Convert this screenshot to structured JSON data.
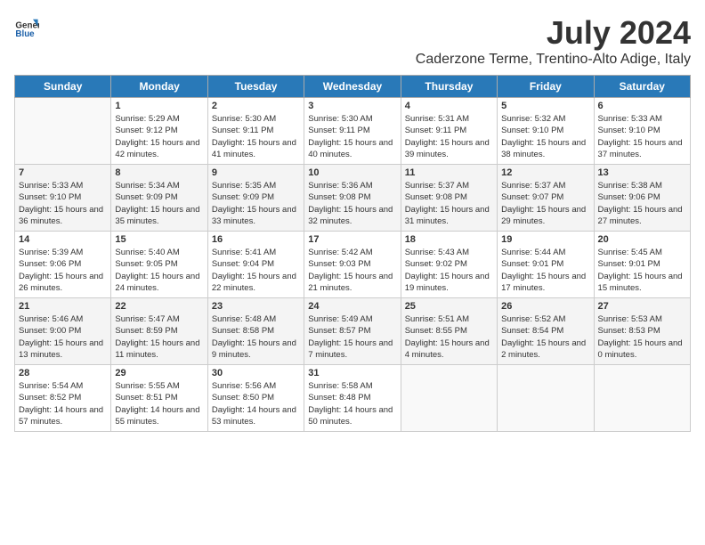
{
  "header": {
    "logo_line1": "General",
    "logo_line2": "Blue",
    "title": "July 2024",
    "subtitle": "Caderzone Terme, Trentino-Alto Adige, Italy"
  },
  "weekdays": [
    "Sunday",
    "Monday",
    "Tuesday",
    "Wednesday",
    "Thursday",
    "Friday",
    "Saturday"
  ],
  "weeks": [
    [
      {
        "day": "",
        "empty": true
      },
      {
        "day": "1",
        "sunrise": "Sunrise: 5:29 AM",
        "sunset": "Sunset: 9:12 PM",
        "daylight": "Daylight: 15 hours and 42 minutes."
      },
      {
        "day": "2",
        "sunrise": "Sunrise: 5:30 AM",
        "sunset": "Sunset: 9:11 PM",
        "daylight": "Daylight: 15 hours and 41 minutes."
      },
      {
        "day": "3",
        "sunrise": "Sunrise: 5:30 AM",
        "sunset": "Sunset: 9:11 PM",
        "daylight": "Daylight: 15 hours and 40 minutes."
      },
      {
        "day": "4",
        "sunrise": "Sunrise: 5:31 AM",
        "sunset": "Sunset: 9:11 PM",
        "daylight": "Daylight: 15 hours and 39 minutes."
      },
      {
        "day": "5",
        "sunrise": "Sunrise: 5:32 AM",
        "sunset": "Sunset: 9:10 PM",
        "daylight": "Daylight: 15 hours and 38 minutes."
      },
      {
        "day": "6",
        "sunrise": "Sunrise: 5:33 AM",
        "sunset": "Sunset: 9:10 PM",
        "daylight": "Daylight: 15 hours and 37 minutes."
      }
    ],
    [
      {
        "day": "7",
        "sunrise": "Sunrise: 5:33 AM",
        "sunset": "Sunset: 9:10 PM",
        "daylight": "Daylight: 15 hours and 36 minutes."
      },
      {
        "day": "8",
        "sunrise": "Sunrise: 5:34 AM",
        "sunset": "Sunset: 9:09 PM",
        "daylight": "Daylight: 15 hours and 35 minutes."
      },
      {
        "day": "9",
        "sunrise": "Sunrise: 5:35 AM",
        "sunset": "Sunset: 9:09 PM",
        "daylight": "Daylight: 15 hours and 33 minutes."
      },
      {
        "day": "10",
        "sunrise": "Sunrise: 5:36 AM",
        "sunset": "Sunset: 9:08 PM",
        "daylight": "Daylight: 15 hours and 32 minutes."
      },
      {
        "day": "11",
        "sunrise": "Sunrise: 5:37 AM",
        "sunset": "Sunset: 9:08 PM",
        "daylight": "Daylight: 15 hours and 31 minutes."
      },
      {
        "day": "12",
        "sunrise": "Sunrise: 5:37 AM",
        "sunset": "Sunset: 9:07 PM",
        "daylight": "Daylight: 15 hours and 29 minutes."
      },
      {
        "day": "13",
        "sunrise": "Sunrise: 5:38 AM",
        "sunset": "Sunset: 9:06 PM",
        "daylight": "Daylight: 15 hours and 27 minutes."
      }
    ],
    [
      {
        "day": "14",
        "sunrise": "Sunrise: 5:39 AM",
        "sunset": "Sunset: 9:06 PM",
        "daylight": "Daylight: 15 hours and 26 minutes."
      },
      {
        "day": "15",
        "sunrise": "Sunrise: 5:40 AM",
        "sunset": "Sunset: 9:05 PM",
        "daylight": "Daylight: 15 hours and 24 minutes."
      },
      {
        "day": "16",
        "sunrise": "Sunrise: 5:41 AM",
        "sunset": "Sunset: 9:04 PM",
        "daylight": "Daylight: 15 hours and 22 minutes."
      },
      {
        "day": "17",
        "sunrise": "Sunrise: 5:42 AM",
        "sunset": "Sunset: 9:03 PM",
        "daylight": "Daylight: 15 hours and 21 minutes."
      },
      {
        "day": "18",
        "sunrise": "Sunrise: 5:43 AM",
        "sunset": "Sunset: 9:02 PM",
        "daylight": "Daylight: 15 hours and 19 minutes."
      },
      {
        "day": "19",
        "sunrise": "Sunrise: 5:44 AM",
        "sunset": "Sunset: 9:01 PM",
        "daylight": "Daylight: 15 hours and 17 minutes."
      },
      {
        "day": "20",
        "sunrise": "Sunrise: 5:45 AM",
        "sunset": "Sunset: 9:01 PM",
        "daylight": "Daylight: 15 hours and 15 minutes."
      }
    ],
    [
      {
        "day": "21",
        "sunrise": "Sunrise: 5:46 AM",
        "sunset": "Sunset: 9:00 PM",
        "daylight": "Daylight: 15 hours and 13 minutes."
      },
      {
        "day": "22",
        "sunrise": "Sunrise: 5:47 AM",
        "sunset": "Sunset: 8:59 PM",
        "daylight": "Daylight: 15 hours and 11 minutes."
      },
      {
        "day": "23",
        "sunrise": "Sunrise: 5:48 AM",
        "sunset": "Sunset: 8:58 PM",
        "daylight": "Daylight: 15 hours and 9 minutes."
      },
      {
        "day": "24",
        "sunrise": "Sunrise: 5:49 AM",
        "sunset": "Sunset: 8:57 PM",
        "daylight": "Daylight: 15 hours and 7 minutes."
      },
      {
        "day": "25",
        "sunrise": "Sunrise: 5:51 AM",
        "sunset": "Sunset: 8:55 PM",
        "daylight": "Daylight: 15 hours and 4 minutes."
      },
      {
        "day": "26",
        "sunrise": "Sunrise: 5:52 AM",
        "sunset": "Sunset: 8:54 PM",
        "daylight": "Daylight: 15 hours and 2 minutes."
      },
      {
        "day": "27",
        "sunrise": "Sunrise: 5:53 AM",
        "sunset": "Sunset: 8:53 PM",
        "daylight": "Daylight: 15 hours and 0 minutes."
      }
    ],
    [
      {
        "day": "28",
        "sunrise": "Sunrise: 5:54 AM",
        "sunset": "Sunset: 8:52 PM",
        "daylight": "Daylight: 14 hours and 57 minutes."
      },
      {
        "day": "29",
        "sunrise": "Sunrise: 5:55 AM",
        "sunset": "Sunset: 8:51 PM",
        "daylight": "Daylight: 14 hours and 55 minutes."
      },
      {
        "day": "30",
        "sunrise": "Sunrise: 5:56 AM",
        "sunset": "Sunset: 8:50 PM",
        "daylight": "Daylight: 14 hours and 53 minutes."
      },
      {
        "day": "31",
        "sunrise": "Sunrise: 5:58 AM",
        "sunset": "Sunset: 8:48 PM",
        "daylight": "Daylight: 14 hours and 50 minutes."
      },
      {
        "day": "",
        "empty": true
      },
      {
        "day": "",
        "empty": true
      },
      {
        "day": "",
        "empty": true
      }
    ]
  ]
}
